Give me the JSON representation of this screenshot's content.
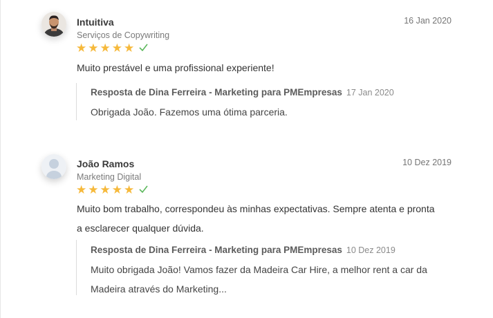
{
  "reviews": [
    {
      "author": "Intuitiva",
      "service": "Serviços de Copywriting",
      "date": "16 Jan 2020",
      "rating": 5,
      "verified_icon": "check-icon",
      "text": "Muito prestável e uma profissional experiente!",
      "reply": {
        "title": "Resposta de Dina Ferreira - Marketing para PMEmpresas",
        "date": "17 Jan 2020",
        "text": "Obrigada João. Fazemos uma ótima parceria."
      }
    },
    {
      "author": "João Ramos",
      "service": "Marketing Digital",
      "date": "10 Dez 2019",
      "rating": 5,
      "verified_icon": "check-icon",
      "text": "Muito bom trabalho, correspondeu às minhas expectativas. Sempre atenta e pronta a esclarecer qualquer dúvida.",
      "reply": {
        "title": "Resposta de Dina Ferreira - Marketing para PMEmpresas",
        "date": "10 Dez 2019",
        "text": "Muito obrigada João! Vamos fazer da Madeira Car Hire, a melhor rent a car da Madeira através do Marketing..."
      }
    }
  ],
  "colors": {
    "star": "#f6b93b",
    "check": "#5cb85c"
  }
}
